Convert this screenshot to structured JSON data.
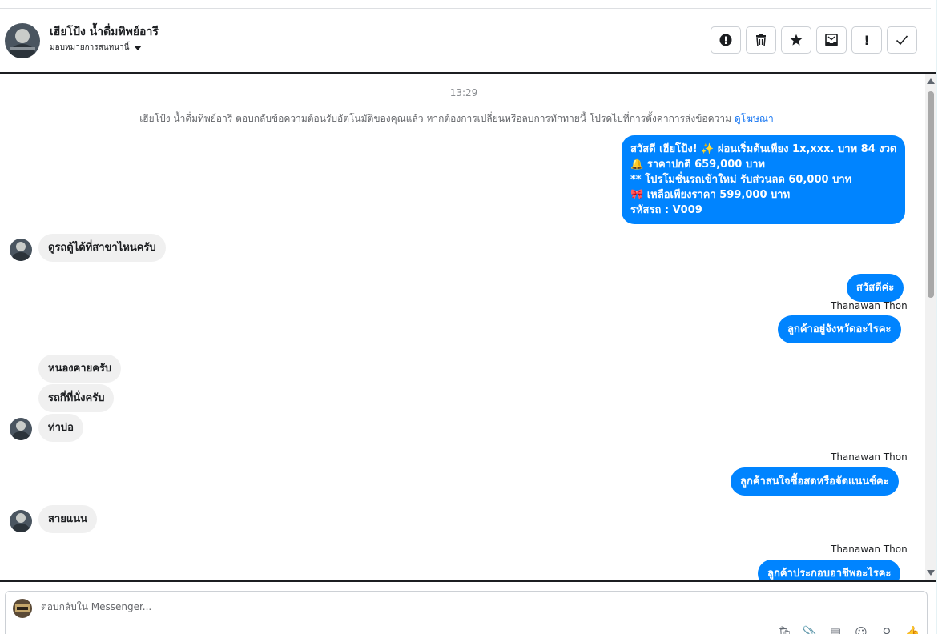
{
  "header": {
    "contact_name": "เฮียโป้ง น้ำดื่มทิพย์อารี",
    "assign_label": "มอบหมายการสนทนานี้",
    "actions": [
      {
        "name": "spam-report-icon",
        "glyph": "⓿"
      },
      {
        "name": "trash-icon",
        "glyph": "🗑"
      },
      {
        "name": "star-icon",
        "glyph": "★"
      },
      {
        "name": "mark-unread-icon",
        "glyph": "✉"
      },
      {
        "name": "exclamation-icon",
        "glyph": "!"
      },
      {
        "name": "check-icon",
        "glyph": "✓"
      }
    ]
  },
  "chat": {
    "timestamp": "13:29",
    "notice_text": "เฮียโป้ง น้ำดื่มทิพย์อารี ตอบกลับข้อความต้อนรับอัตโนมัติของคุณแล้ว หากต้องการเปลี่ยนหรือลบการทักทายนี้ โปรดไปที่การตั้งค่าการส่งข้อความ",
    "notice_link": "ดูโฆษณา",
    "promo_lines": [
      "สวัสดี เฮียโป้ง! ✨  ผ่อนเริ่มต้นเพียง 1x,xxx. บาท 84 งวด",
      "🔔 ราคาปกติ 659,000 บาท",
      "** โปรโมชั่นรถเข้าใหม่ รับส่วนลด 60,000 บาท",
      "🎀  เหลือเพียงราคา 599,000 บาท",
      " รหัสรถ : V009"
    ],
    "messages": {
      "in_1": "ดูรถตู้ได้ที่สาขาไหนครับ",
      "out_1": "สวัสดีค่ะ",
      "sender_1": "Thanawan Thon",
      "out_2": "ลูกค้าอยู่จังหวัดอะไรคะ",
      "in_2": "หนองคายครับ",
      "in_3": "รถกี่ที่นั่งครับ",
      "in_4": "ท่าบ่อ",
      "sender_2": "Thanawan Thon",
      "out_3": "ลูกค้าสนใจซื้อสดหรือจัดแนนซ์คะ",
      "in_5": "สายแนน",
      "sender_3": "Thanawan Thon",
      "out_4": "ลูกค้าประกอบอาชีพอะไรคะ"
    }
  },
  "composer": {
    "placeholder": "ตอบกลับใน Messenger...",
    "tools": [
      {
        "name": "shop-bag-icon",
        "glyph": "🛍"
      },
      {
        "name": "attach-icon",
        "glyph": "📎"
      },
      {
        "name": "saved-reply-icon",
        "glyph": "▤"
      },
      {
        "name": "emoji-icon",
        "glyph": "☺"
      },
      {
        "name": "sticker-icon",
        "glyph": "⚲"
      },
      {
        "name": "like-icon",
        "glyph": "👍"
      }
    ]
  },
  "colors": {
    "outgoing_bubble": "#0084ff",
    "incoming_bubble": "#f0f0f0",
    "link": "#1877f2"
  }
}
